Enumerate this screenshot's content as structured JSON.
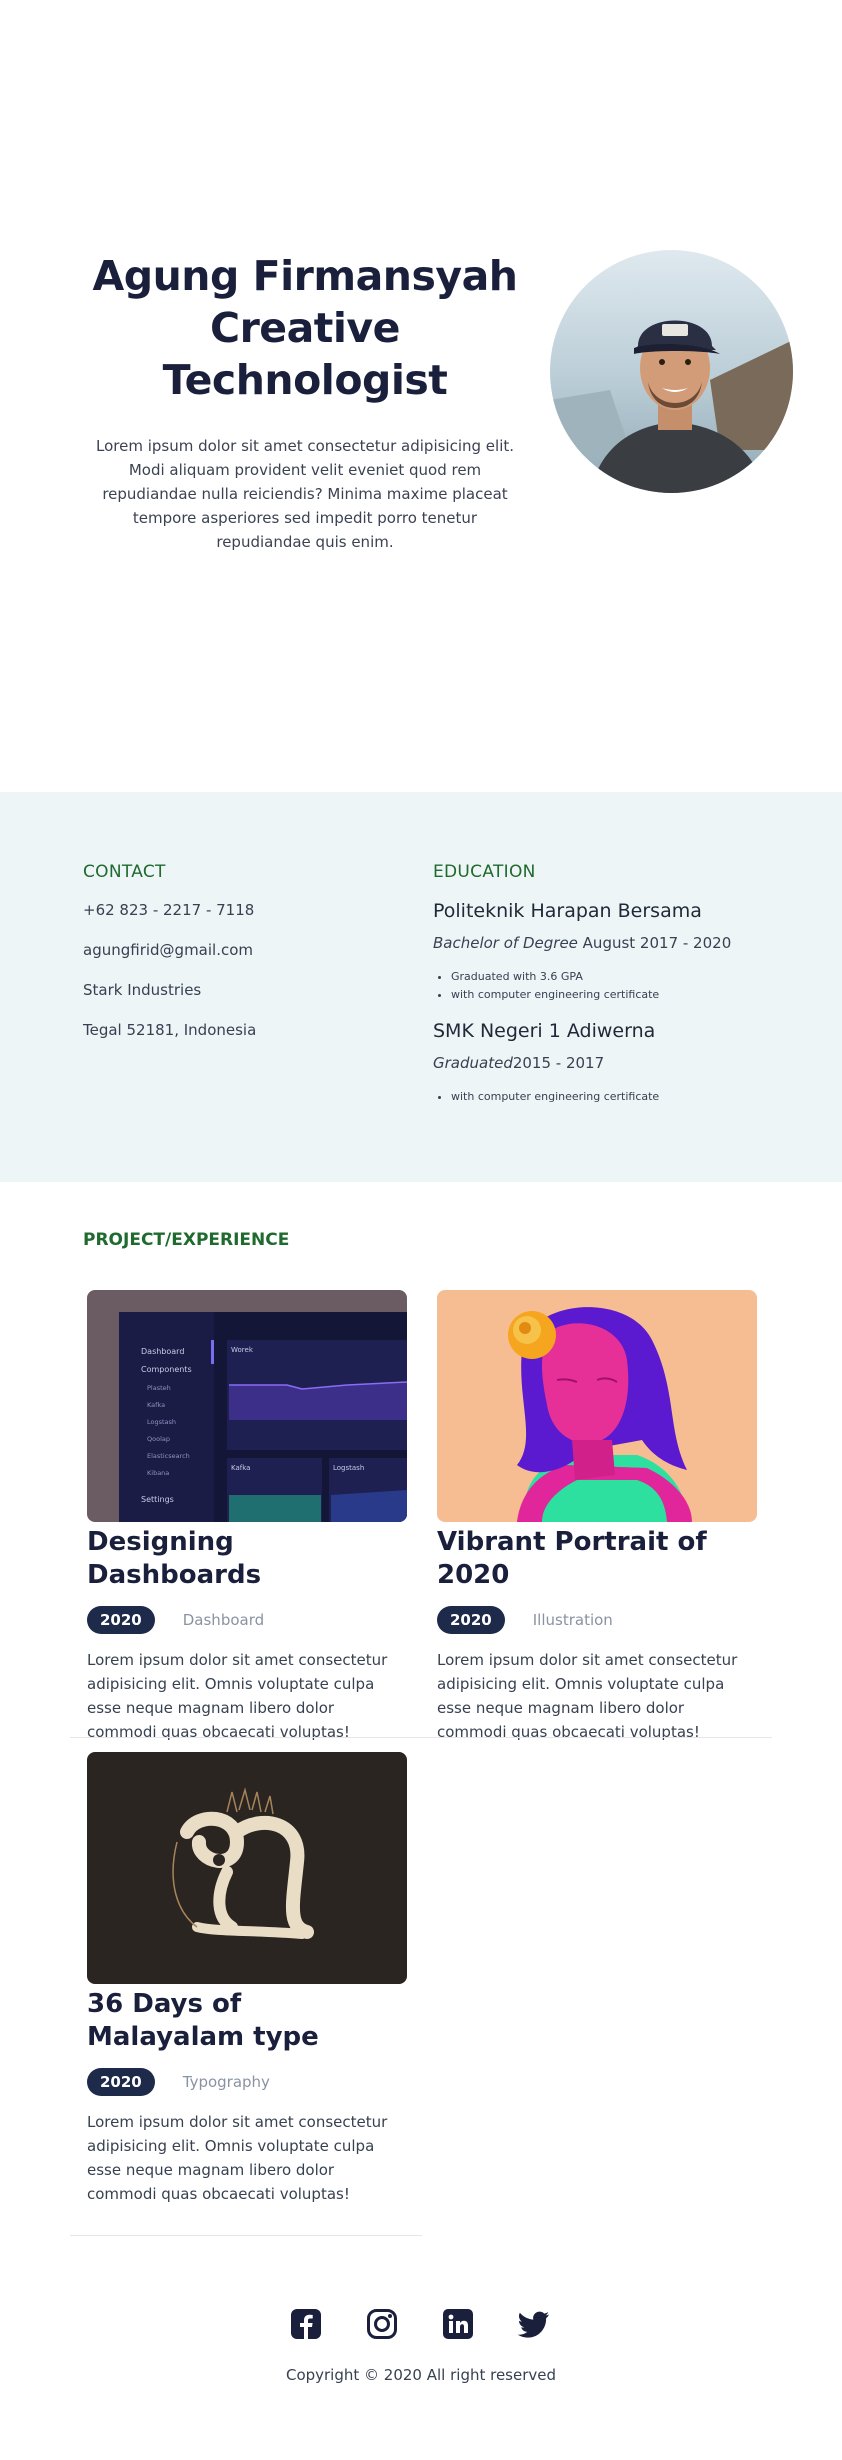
{
  "hero": {
    "title_line1": "Agung Firmansyah",
    "title_line2": "Creative",
    "title_line3": "Technologist",
    "description": "Lorem ipsum dolor sit amet consectetur adipisicing elit. Modi aliquam provident velit eveniet quod rem repudiandae nulla reiciendis? Minima maxime placeat tempore asperiores sed impedit porro tenetur repudiandae quis enim."
  },
  "contact": {
    "heading": "CONTACT",
    "phone": "+62 823 - 2217 - 7118",
    "email": "agungfirid@gmail.com",
    "company": "Stark Industries",
    "address": "Tegal 52181, Indonesia"
  },
  "education": {
    "heading": "EDUCATION",
    "schools": [
      {
        "name": "Politeknik Harapan Bersama",
        "degree": "Bachelor of Degree",
        "period": " August 2017 - 2020",
        "notes": [
          "Graduated with 3.6 GPA",
          "with computer engineering certificate"
        ]
      },
      {
        "name": "SMK Negeri 1 Adiwerna",
        "degree": "Graduated",
        "period": "2015 - 2017",
        "notes": [
          "with computer engineering certificate"
        ]
      }
    ]
  },
  "projects": {
    "heading": "PROJECT/EXPERIENCE",
    "items": [
      {
        "title": "Designing Dashboards",
        "year": "2020",
        "category": "Dashboard",
        "description": "Lorem ipsum dolor sit amet consectetur adipisicing elit. Omnis voluptate culpa esse neque magnam libero dolor commodi quas obcaecati voluptas!",
        "dashboard": {
          "nav_dashboard": "Dashboard",
          "nav_components": "Components",
          "sub_items": [
            "Plasteh",
            "Kafka",
            "Logstash",
            "Qoolap",
            "Elasticsearch",
            "Kibana"
          ],
          "nav_settings": "Settings",
          "panel_worek": "Worek",
          "panel_kafka": "Kafka",
          "panel_logstash": "Logstash"
        }
      },
      {
        "title": "Vibrant Portrait of 2020",
        "year": "2020",
        "category": "Illustration",
        "description": "Lorem ipsum dolor sit amet consectetur adipisicing elit. Omnis voluptate culpa esse neque magnam libero dolor commodi quas obcaecati voluptas!"
      },
      {
        "title": "36 Days of Malayalam type",
        "year": "2020",
        "category": "Typography",
        "description": "Lorem ipsum dolor sit amet consectetur adipisicing elit. Omnis voluptate culpa esse neque magnam libero dolor commodi quas obcaecati voluptas!"
      }
    ]
  },
  "footer": {
    "copyright": "Copyright © 2020 All right reserved",
    "socials": [
      "facebook-icon",
      "instagram-icon",
      "linkedin-icon",
      "twitter-icon"
    ]
  },
  "colors": {
    "accent_green": "#1f6a2e",
    "navy": "#1a1f3c",
    "badge": "#1e2a4a",
    "info_bg": "#eef5f7"
  }
}
